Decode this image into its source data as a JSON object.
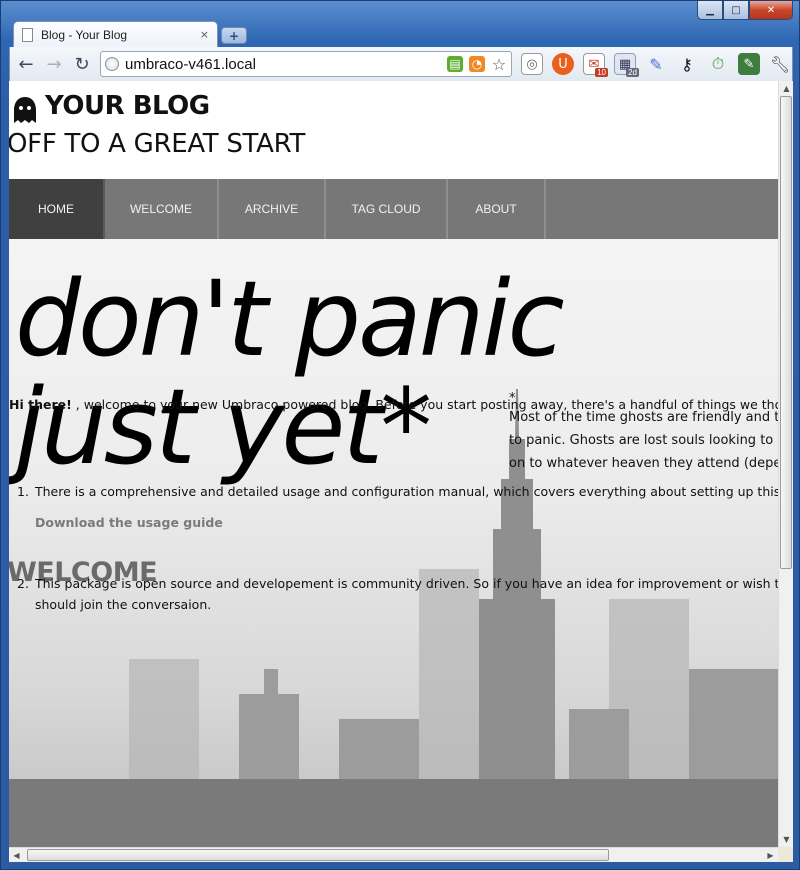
{
  "browser": {
    "tab_title": "Blog - Your Blog",
    "tab_close": "×",
    "new_tab": "+",
    "url": "umbraco-v461.local",
    "back": "←",
    "forward": "→",
    "reload": "↻",
    "caption": {
      "minimize": "▁",
      "maximize": "□",
      "close": "✕"
    },
    "extension_badges": {
      "gmail": "10",
      "calendar": "2d"
    }
  },
  "site": {
    "title": "YOUR BLOG",
    "tagline": "OFF TO A GREAT START",
    "nav": [
      "HOME",
      "WELCOME",
      "ARCHIVE",
      "TAG CLOUD",
      "ABOUT"
    ],
    "nav_active": "HOME",
    "hero_line1": "don't panic",
    "hero_line2": "just yet*",
    "note_star": "*",
    "note_line1": "Most of the time ghosts are friendly and th",
    "note_line2": "to panic. Ghosts are lost souls looking to l",
    "note_line3": "on to whatever heaven they attend (deper",
    "welcome_heading": "WELCOME",
    "intro_bold": "Hi there!",
    "intro_text": " , welcome to your new Umbraco powered blog. Before you start posting away, there's a handful of things we thought you",
    "list": [
      {
        "num": "1.",
        "text": "There is a comprehensive and detailed usage and configuration manual, which covers everything about setting up this blog and"
      },
      {
        "num": "2.",
        "text": "This package is open source and developement is community driven. So if you have an idea for improvement or wish to be a par",
        "text2": "should join the conversaion."
      }
    ],
    "download_link": "Download the usage guide"
  }
}
